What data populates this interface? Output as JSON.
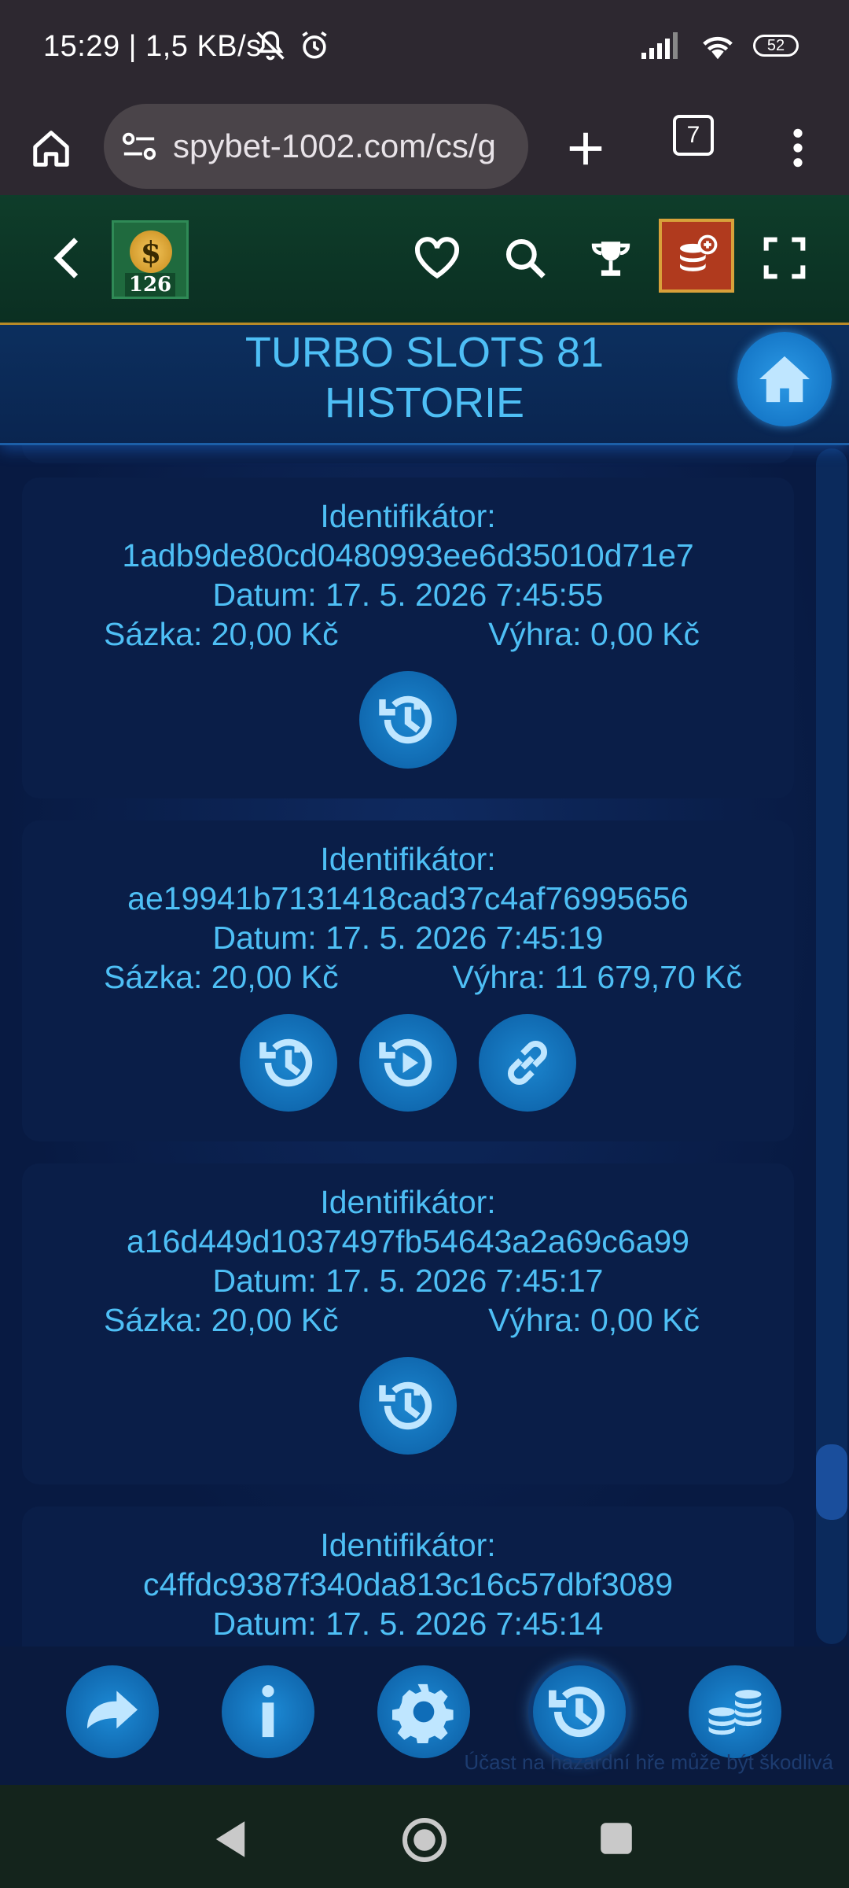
{
  "status_bar": {
    "time": "15:29 | 1,5 KB/s",
    "battery": "52"
  },
  "browser": {
    "url": "spybet-1002.com/cs/g",
    "tab_count": "7"
  },
  "game_header": {
    "level": "126"
  },
  "title": {
    "line1": "TURBO SLOTS 81",
    "line2": "HISTORIE"
  },
  "history": [
    {
      "id_label": "Identifikátor:",
      "id": "1adb9de80cd0480993ee6d35010d71e7",
      "date": "Datum: 17. 5. 2026 7:45:55",
      "bet": "Sázka: 20,00 Kč",
      "win": "Výhra: 0,00 Kč",
      "actions": [
        "history-detail-icon"
      ]
    },
    {
      "id_label": "Identifikátor:",
      "id": "ae19941b7131418cad37c4af76995656",
      "date": "Datum: 17. 5. 2026 7:45:19",
      "bet": "Sázka: 20,00 Kč",
      "win": "Výhra: 11 679,70 Kč",
      "actions": [
        "history-detail-icon",
        "replay-icon",
        "link-icon"
      ]
    },
    {
      "id_label": "Identifikátor:",
      "id": "a16d449d1037497fb54643a2a69c6a99",
      "date": "Datum: 17. 5. 2026 7:45:17",
      "bet": "Sázka: 20,00 Kč",
      "win": "Výhra: 0,00 Kč",
      "actions": [
        "history-detail-icon"
      ]
    },
    {
      "id_label": "Identifikátor:",
      "id": "c4ffdc9387f340da813c16c57dbf3089",
      "date": "Datum: 17. 5. 2026 7:45:14"
    }
  ],
  "bottom_bar": {
    "buttons": [
      "exit-icon",
      "info-icon",
      "settings-icon",
      "history-icon",
      "bet-coins-icon"
    ],
    "active": "history-icon",
    "disclaimer": "Účast na hazardní hře může být škodlivá"
  },
  "colors": {
    "accent": "#4ebff5",
    "button": "#1c86cf",
    "background": "#0a1a3e"
  }
}
